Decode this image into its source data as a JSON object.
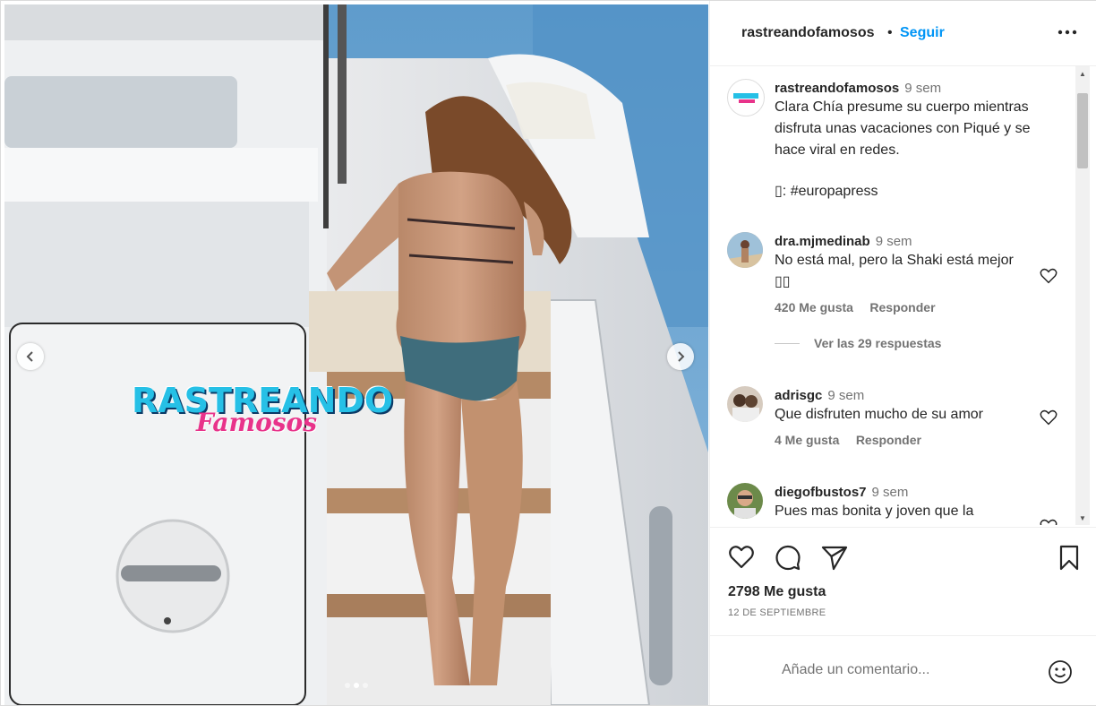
{
  "post": {
    "author": "rastreandofamosos",
    "follow_label": "Seguir",
    "separator": "•",
    "media": {
      "watermark_main": "RASTREANDO",
      "watermark_script": "Famosos",
      "slide_count": 3,
      "active_slide": 2
    },
    "caption": {
      "username": "rastreandofamosos",
      "time": "9 sem",
      "text": "Clara Chía presume su cuerpo mientras disfruta unas vacaciones con Piqué y se hace viral en redes.",
      "credit": "▯: #europapress"
    },
    "comments": [
      {
        "username": "dra.mjmedinab",
        "time": "9 sem",
        "text": "No está mal, pero la Shaki está mejor ▯▯",
        "likes": "420 Me gusta",
        "reply_label": "Responder",
        "view_replies": "Ver las 29 respuestas"
      },
      {
        "username": "adrisgc",
        "time": "9 sem",
        "text": "Que disfruten mucho de su amor",
        "likes": "4 Me gusta",
        "reply_label": "Responder"
      },
      {
        "username": "diegofbustos7",
        "time": "9 sem",
        "text": "Pues mas bonita y joven que la"
      }
    ],
    "like_count": "2798 Me gusta",
    "date": "12 DE SEPTIEMBRE",
    "comment_placeholder": "Añade un comentario..."
  },
  "icons": {
    "more": "more-horizontal-icon",
    "like": "heart-icon",
    "comment": "comment-bubble-icon",
    "share": "paper-plane-icon",
    "save": "bookmark-icon",
    "emoji": "smiley-icon",
    "prev": "chevron-left-icon",
    "next": "chevron-right-icon"
  },
  "colors": {
    "link_blue": "#0095f6",
    "text": "#262626",
    "muted": "#737373",
    "watermark_cyan": "#26c0e6",
    "watermark_pink": "#e8338a"
  }
}
